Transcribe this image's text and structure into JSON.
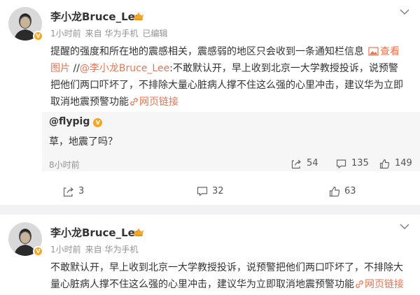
{
  "post1": {
    "username": "李小龙Bruce_Lee",
    "time": "1小时前",
    "source": "来自 华为手机",
    "edited": "已编辑",
    "text_line1_a": "提醒的强度和所在地的震感相关，震感弱的地区只会收到一条通知栏信息",
    "view_image": "查看",
    "text_line2_a": "图片",
    "text_line2_b": " //",
    "text_line2_mention": "@李小龙Bruce_Lee",
    "text_line2_c": ":不敢默认开，早上收到北京一大学教授投诉，说预警",
    "text_line3": "把他们两口吓坏了，不排除大量心脏病人撑不住这么强的心里冲击，建议华为立即",
    "text_line4": "取消地震预警功能",
    "web_link": "网页链接",
    "quote": {
      "username": "@flypig",
      "text": "草，地震了吗？",
      "time": "8小时前",
      "repost_count": "54",
      "comment_count": "135",
      "like_count": "149"
    },
    "repost_count": "3",
    "comment_count": "32",
    "like_count": "63"
  },
  "post2": {
    "username": "李小龙Bruce_Lee",
    "time": "1小时前",
    "source": "来自 华为手机",
    "text_line1": "不敢默认开，早上收到北京一大学教授投诉，说预警把他们两口吓坏了，不排除大",
    "text_line2": "量心脏病人撑不住这么强的心里冲击，建议华为立即取消地震预警功能",
    "web_link": "网页链接"
  },
  "colors": {
    "link": "#eb7350",
    "meta": "#939393",
    "vip": "#f5a623"
  }
}
